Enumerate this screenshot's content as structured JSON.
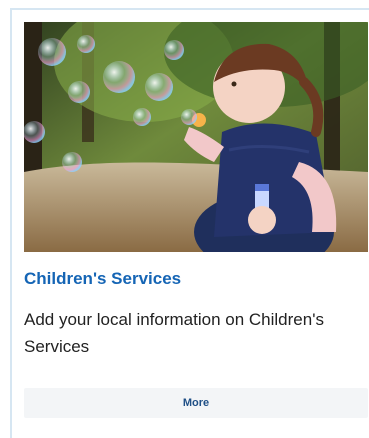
{
  "card": {
    "image_alt": "Child blowing bubbles",
    "title": "Children's Services",
    "description": "Add your local information on Children's Services",
    "more_label": "More"
  },
  "colors": {
    "title": "#1565b5",
    "border": "#d6e6f2",
    "button_bg": "#f3f5f7",
    "button_text": "#1f4f86"
  }
}
